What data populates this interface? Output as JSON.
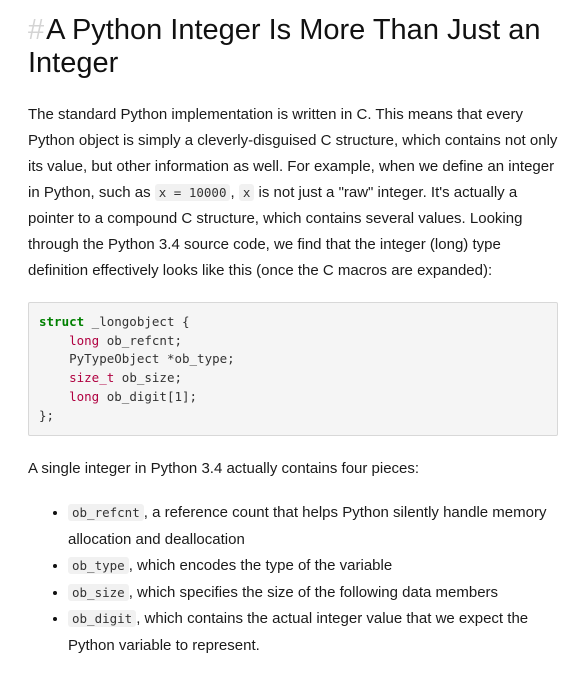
{
  "heading": {
    "anchor": "#",
    "title": "A Python Integer Is More Than Just an Integer"
  },
  "intro": {
    "part1": "The standard Python implementation is written in C. This means that every Python object is simply a cleverly-disguised C structure, which contains not only its value, but other information as well. For example, when we define an integer in Python, such as ",
    "code1": "x = 10000",
    "part2": ", ",
    "code2": "x",
    "part3": " is not just a \"raw\" integer. It's actually a pointer to a compound C structure, which contains several values. Looking through the Python 3.4 source code, we find that the integer (long) type definition effectively looks like this (once the C macros are expanded):"
  },
  "code": {
    "kw_struct": "struct",
    "struct_name": " _longobject {",
    "lines": [
      {
        "type": "long",
        "rest": " ob_refcnt;"
      },
      {
        "type": "",
        "rest": "PyTypeObject *ob_type;"
      },
      {
        "type": "size_t",
        "rest": " ob_size;"
      },
      {
        "type": "long",
        "rest": " ob_digit[1];"
      }
    ],
    "closing": "};"
  },
  "summary": "A single integer in Python 3.4 actually contains four pieces:",
  "items": [
    {
      "code": "ob_refcnt",
      "text": ", a reference count that helps Python silently handle memory allocation and deallocation"
    },
    {
      "code": "ob_type",
      "text": ", which encodes the type of the variable"
    },
    {
      "code": "ob_size",
      "text": ", which specifies the size of the following data members"
    },
    {
      "code": "ob_digit",
      "text": ", which contains the actual integer value that we expect the Python variable to represent."
    }
  ]
}
